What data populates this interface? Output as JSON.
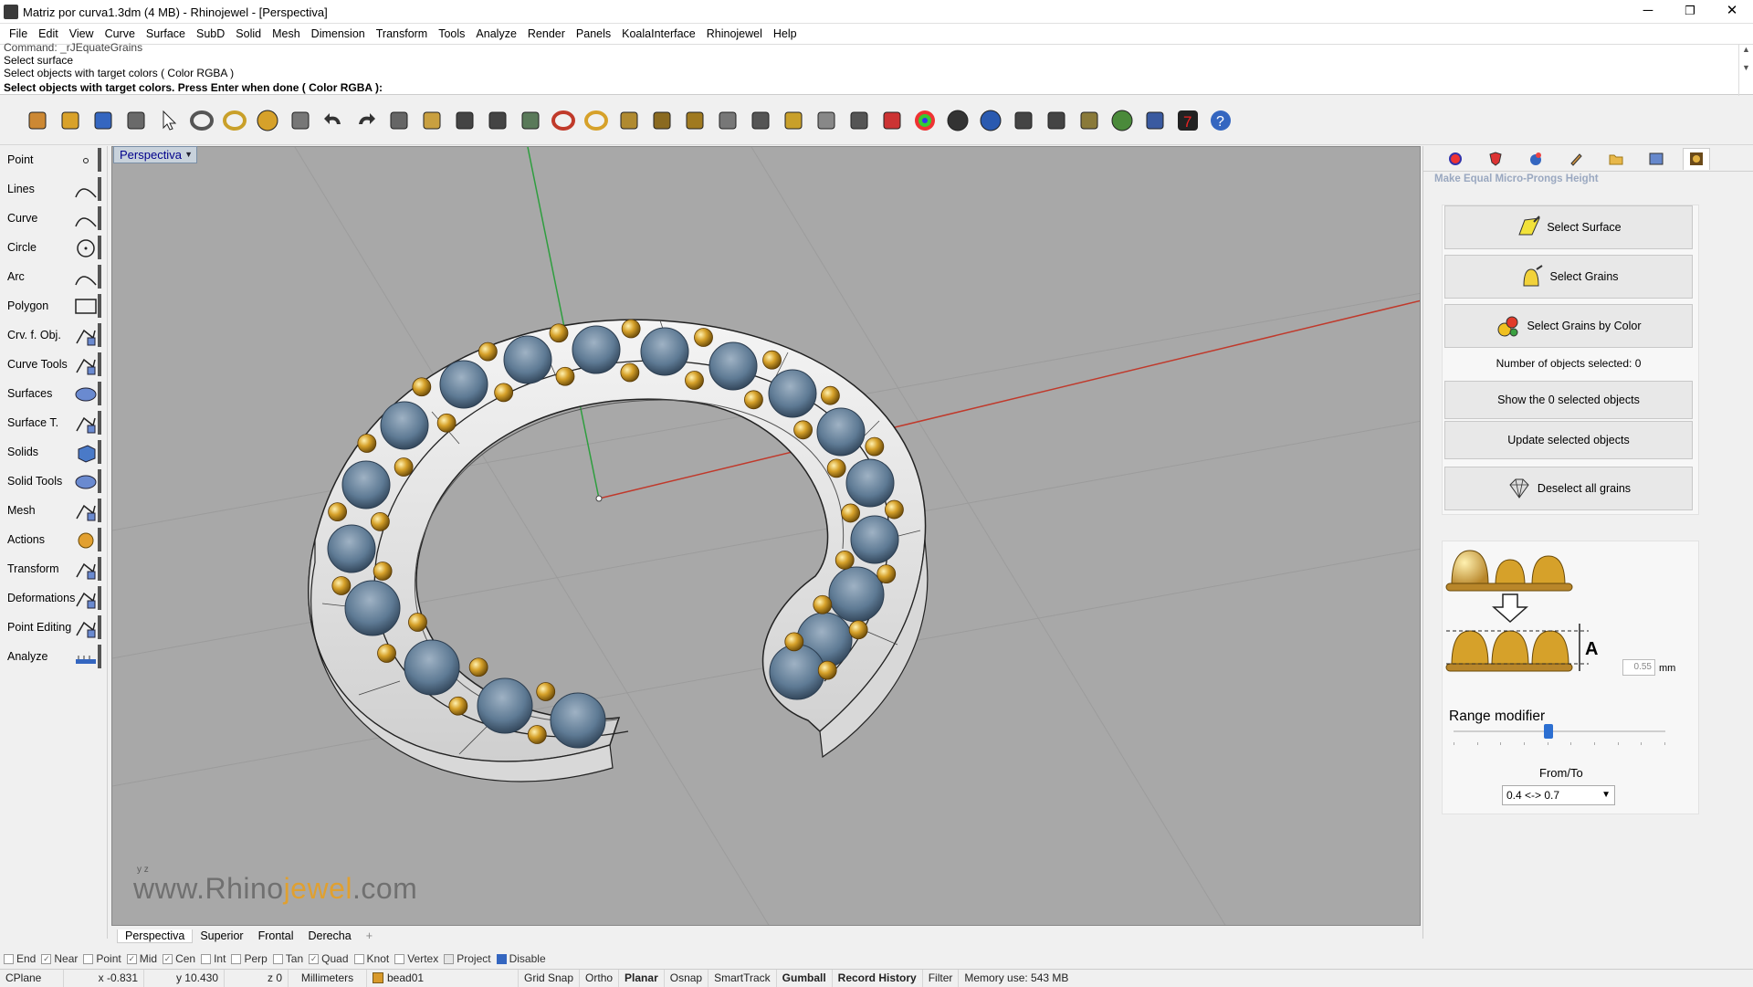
{
  "window": {
    "title": "Matriz por curva1.3dm (4 MB) - Rhinojewel - [Perspectiva]",
    "minimize": "─",
    "maximize": "❐",
    "close": "✕"
  },
  "menu": [
    "File",
    "Edit",
    "View",
    "Curve",
    "Surface",
    "SubD",
    "Solid",
    "Mesh",
    "Dimension",
    "Transform",
    "Tools",
    "Analyze",
    "Render",
    "Panels",
    "KoalaInterface",
    "Rhinojewel",
    "Help"
  ],
  "command": {
    "history": [
      "Command: _rJEquateGrains",
      "Select surface",
      "Select objects with target colors ( Color  RGBA )"
    ],
    "prompt": "Select objects with target colors. Press Enter when done ( Color  RGBA ):"
  },
  "toolbar": [
    "new-icon",
    "open-icon",
    "save-icon",
    "save-as-icon",
    "select-arrow-icon",
    "gem-icon",
    "ring-icon",
    "sphere-icon",
    "prongs-icon",
    "undo-icon",
    "redo-icon",
    "copy-icon",
    "paste-icon",
    "zoom-extents-icon",
    "zoom-icon",
    "render-grid-icon",
    "cabochon-icon",
    "ring-band-icon",
    "pipe-icon",
    "shank-icon",
    "prong-set-icon",
    "measure-icon",
    "snap-circle-icon",
    "scale-icon",
    "light-bulb-icon",
    "lock-icon",
    "shield-icon",
    "color-wheel-icon",
    "material-sphere-icon",
    "blue-sphere-icon",
    "dimension-icon",
    "curve-tool-icon",
    "gear-settings-icon",
    "globe-icon",
    "cube-icon",
    "version-7-icon",
    "help-icon"
  ],
  "sidebar": [
    {
      "label": "Point",
      "icon": "point-icon"
    },
    {
      "label": "Lines",
      "icon": "lines-icon"
    },
    {
      "label": "Curve",
      "icon": "curve-icon"
    },
    {
      "label": "Circle",
      "icon": "circle-icon"
    },
    {
      "label": "Arc",
      "icon": "arc-icon"
    },
    {
      "label": "Polygon",
      "icon": "polygon-icon"
    },
    {
      "label": "Crv. f. Obj.",
      "icon": "curve-from-object-icon"
    },
    {
      "label": "Curve Tools",
      "icon": "curve-tools-icon"
    },
    {
      "label": "Surfaces",
      "icon": "surfaces-icon"
    },
    {
      "label": "Surface T.",
      "icon": "surface-tools-icon"
    },
    {
      "label": "Solids",
      "icon": "solids-icon"
    },
    {
      "label": "Solid Tools",
      "icon": "solid-tools-icon"
    },
    {
      "label": "Mesh",
      "icon": "mesh-icon"
    },
    {
      "label": "Actions",
      "icon": "actions-icon"
    },
    {
      "label": "Transform",
      "icon": "transform-icon"
    },
    {
      "label": "Deformations",
      "icon": "deformations-icon"
    },
    {
      "label": "Point Editing",
      "icon": "point-editing-icon"
    },
    {
      "label": "Analyze",
      "icon": "analyze-icon"
    }
  ],
  "viewport": {
    "name": "Perspectiva",
    "watermark_pre": "www.Rhino",
    "watermark_mid": "jewel",
    "watermark_post": ".com",
    "axis_label": "y  z"
  },
  "view_tabs": [
    "Perspectiva",
    "Superior",
    "Frontal",
    "Derecha"
  ],
  "view_tab_add": "+",
  "panel": {
    "title": "Make Equal Micro-Prongs Height",
    "buttons": {
      "select_surface": "Select Surface",
      "select_grains": "Select Grains",
      "select_grains_by_color": "Select Grains by Color",
      "show_selected": "Show the 0 selected objects",
      "update_selected": "Update selected objects",
      "deselect_all": "Deselect all grains"
    },
    "selected_info": "Number of objects selected: 0",
    "height_label": "A",
    "height_value": "0.55",
    "height_unit": "mm",
    "range_label": "Range modifier",
    "range_fraction": 0.45,
    "fromto_label": "From/To",
    "fromto_value": "0.4 <-> 0.7"
  },
  "osnaps": [
    {
      "label": "End",
      "checked": false
    },
    {
      "label": "Near",
      "checked": true
    },
    {
      "label": "Point",
      "checked": false
    },
    {
      "label": "Mid",
      "checked": true
    },
    {
      "label": "Cen",
      "checked": true
    },
    {
      "label": "Int",
      "checked": false
    },
    {
      "label": "Perp",
      "checked": false
    },
    {
      "label": "Tan",
      "checked": false
    },
    {
      "label": "Quad",
      "checked": true
    },
    {
      "label": "Knot",
      "checked": false
    },
    {
      "label": "Vertex",
      "checked": false
    },
    {
      "label": "Project",
      "checked": false,
      "disabled": true
    },
    {
      "label": "Disable",
      "checked": false,
      "blue": true
    }
  ],
  "status": {
    "cplane": "CPlane",
    "x": "x -0.831",
    "y": "y 10.430",
    "z": "z 0",
    "units": "Millimeters",
    "layer": "bead01",
    "grid_snap": "Grid Snap",
    "ortho": "Ortho",
    "planar": "Planar",
    "osnap": "Osnap",
    "smarttrack": "SmartTrack",
    "gumball": "Gumball",
    "record_history": "Record History",
    "filter": "Filter",
    "memory": "Memory use: 543 MB"
  },
  "colors": {
    "viewport_bg": "#a8a8a8",
    "gold": "#d6a12a",
    "stone": "#5e7a94",
    "x_axis": "#c0392b",
    "y_axis": "#2e9e3e",
    "accent": "#2c6fd1"
  }
}
